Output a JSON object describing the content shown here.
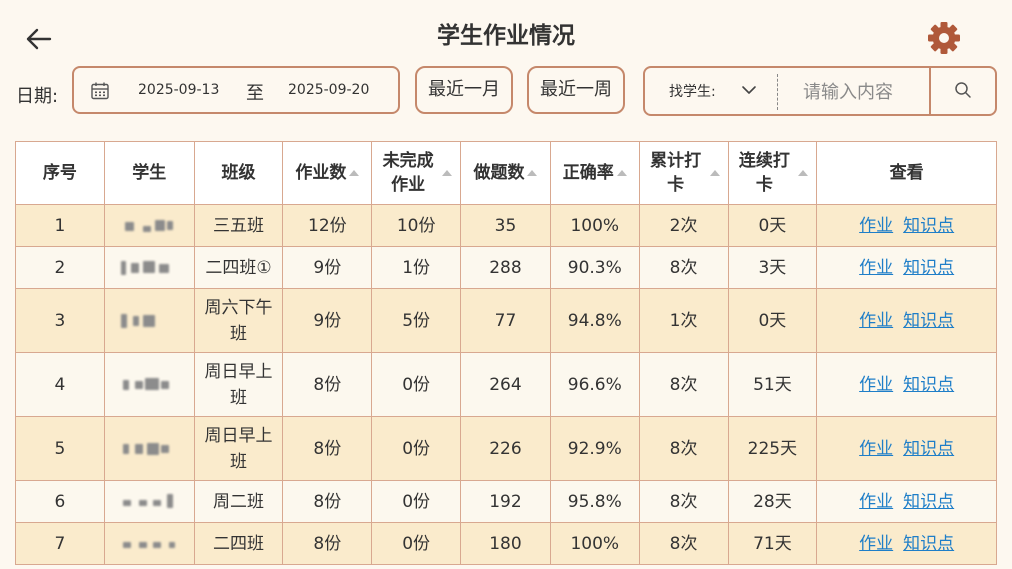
{
  "header": {
    "title": "学生作业情况"
  },
  "filters": {
    "date_label": "日期:",
    "start_date": "2025-09-13",
    "to_label": "至",
    "end_date": "2025-09-20",
    "recent_month": "最近一月",
    "recent_week": "最近一周",
    "find_student_label": "找学生:",
    "search_placeholder": "请输入内容"
  },
  "colors": {
    "accent_border": "#c5886b",
    "gear": "#b0593a",
    "red": "#e51616",
    "green": "#1aa31a",
    "link": "#1e7ec8"
  },
  "icons": {
    "back": "arrow-left-icon",
    "settings": "gear-icon",
    "calendar": "calendar-icon",
    "dropdown": "chevron-down-icon",
    "search": "search-icon"
  },
  "table": {
    "headers": {
      "index": "序号",
      "student": "学生",
      "class": "班级",
      "homework": "作业数",
      "unfinished": "未完成作业",
      "questions": "做题数",
      "accuracy": "正确率",
      "total_checkin": "累计打卡",
      "streak": "连续打卡",
      "view": "查看"
    },
    "link_homework": "作业",
    "link_knowledge": "知识点",
    "rows": [
      {
        "index": "1",
        "class": "三五班",
        "homework": "12份",
        "unfinished": "10份",
        "questions": "35",
        "accuracy": "100%",
        "total_checkin": "2次",
        "streak": "0天"
      },
      {
        "index": "2",
        "class": "二四班①",
        "homework": "9份",
        "unfinished": "1份",
        "questions": "288",
        "accuracy": "90.3%",
        "total_checkin": "8次",
        "streak": "3天"
      },
      {
        "index": "3",
        "class": "周六下午班",
        "homework": "9份",
        "unfinished": "5份",
        "questions": "77",
        "accuracy": "94.8%",
        "total_checkin": "1次",
        "streak": "0天"
      },
      {
        "index": "4",
        "class": "周日早上班",
        "homework": "8份",
        "unfinished": "0份",
        "questions": "264",
        "accuracy": "96.6%",
        "total_checkin": "8次",
        "streak": "51天"
      },
      {
        "index": "5",
        "class": "周日早上班",
        "homework": "8份",
        "unfinished": "0份",
        "questions": "226",
        "accuracy": "92.9%",
        "total_checkin": "8次",
        "streak": "225天"
      },
      {
        "index": "6",
        "class": "周二班",
        "homework": "8份",
        "unfinished": "0份",
        "questions": "192",
        "accuracy": "95.8%",
        "total_checkin": "8次",
        "streak": "28天"
      },
      {
        "index": "7",
        "class": "二四班",
        "homework": "8份",
        "unfinished": "0份",
        "questions": "180",
        "accuracy": "100%",
        "total_checkin": "8次",
        "streak": "71天"
      }
    ]
  }
}
